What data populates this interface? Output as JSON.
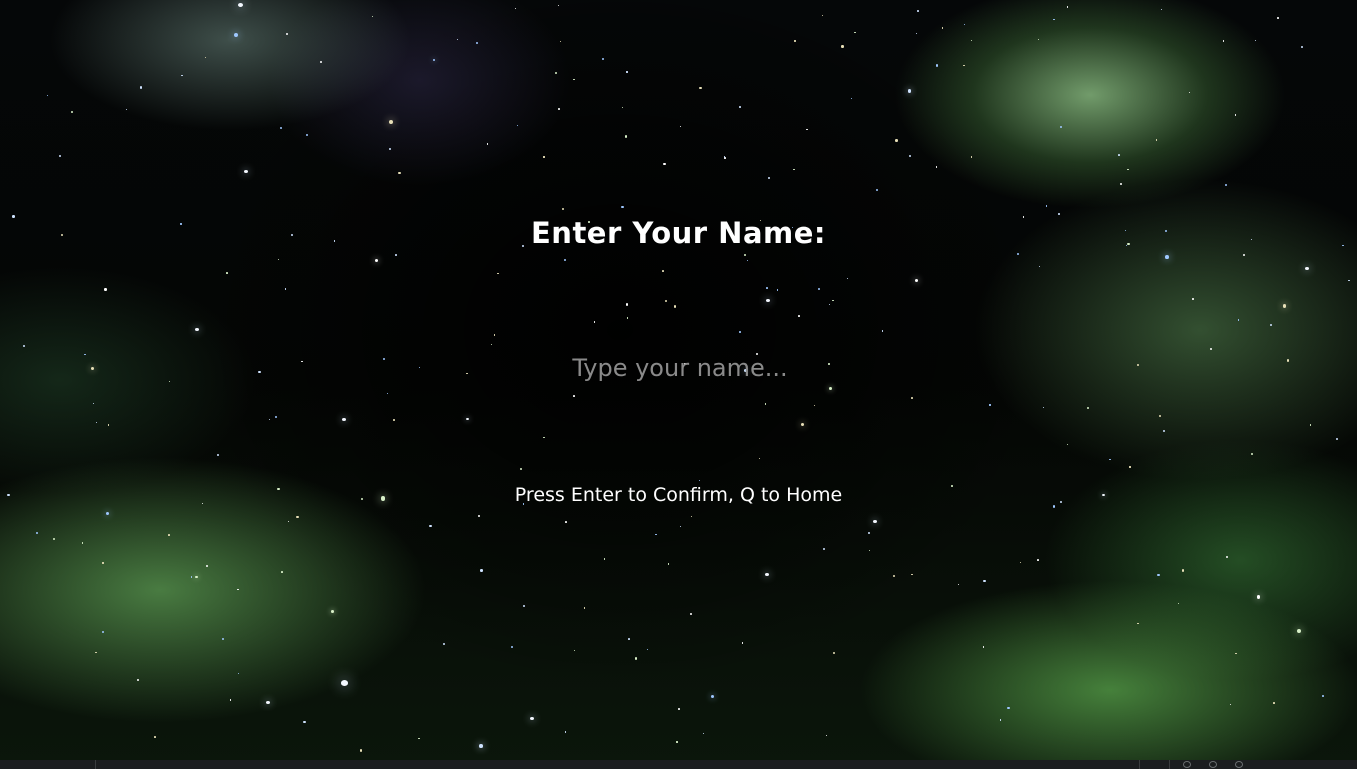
{
  "scene": {
    "title": "Enter Your Name:",
    "name_input": {
      "value": "",
      "placeholder": "Type your name..."
    },
    "hint": "Press Enter to Confirm, Q to Home"
  },
  "taskbar": {
    "tray_icons": [
      "wifi-icon",
      "shield-icon",
      "microphone-icon"
    ]
  }
}
